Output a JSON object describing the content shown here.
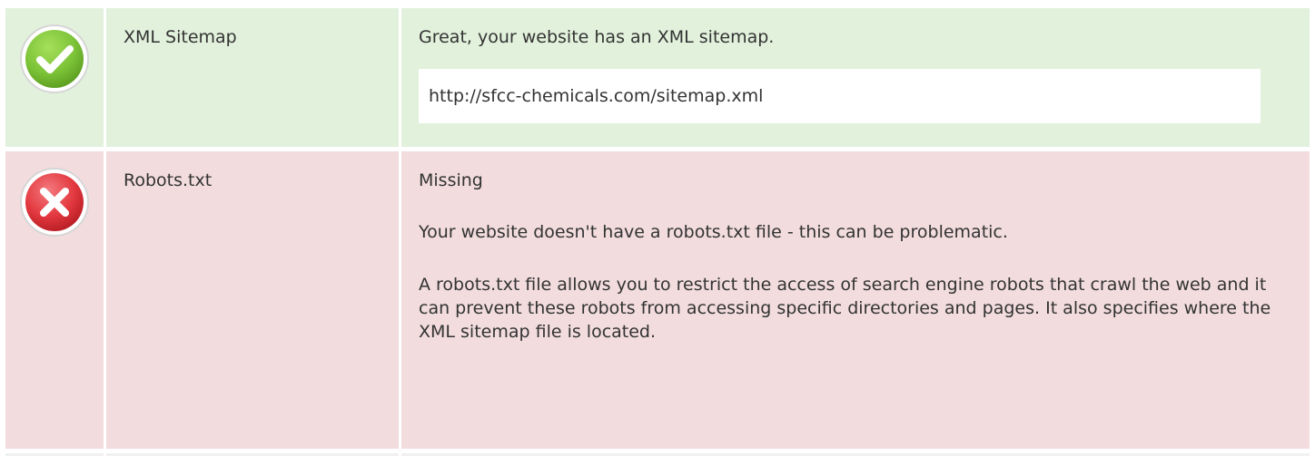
{
  "colors": {
    "pass_bg": "#e2f1dc",
    "fail_bg": "#f2dcde",
    "pass_icon": "#7cc338",
    "fail_icon": "#e2373e"
  },
  "rows": [
    {
      "status": "pass",
      "icon": "check-circle-icon",
      "label": "XML Sitemap",
      "message": "Great, your website has an XML sitemap.",
      "url": "http://sfcc-chemicals.com/sitemap.xml"
    },
    {
      "status": "fail",
      "icon": "x-circle-icon",
      "label": "Robots.txt",
      "status_text": "Missing",
      "message": "Your website doesn't have a robots.txt file - this can be problematic.",
      "explanation": "A robots.txt file allows you to restrict the access of search engine robots that crawl the web and it can prevent these robots from accessing specific directories and pages. It also specifies where the XML sitemap file is located."
    }
  ]
}
